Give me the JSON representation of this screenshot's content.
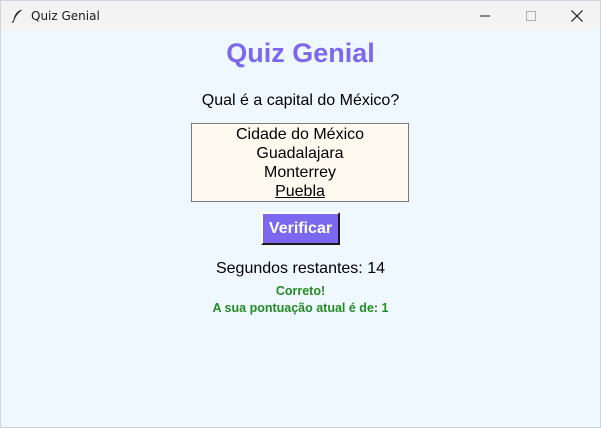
{
  "window": {
    "title": "Quiz Genial",
    "icon": "feather-icon",
    "controls": [
      "minimize-icon",
      "maximize-icon",
      "close-icon"
    ]
  },
  "quiz": {
    "heading": "Quiz Genial",
    "question": "Qual é a capital do México?",
    "options": [
      "Cidade do México",
      "Guadalajara",
      "Monterrey",
      "Puebla"
    ],
    "focused_option_index": 3,
    "check_button_label": "Verificar",
    "timer_text": "Segundos restantes: 14",
    "feedback_line1": "Correto!",
    "feedback_line2": "A sua pontuação atual é de: 1"
  },
  "colors": {
    "accent": "#7b68ee",
    "background": "#f0f8ff",
    "listbox_background": "#fffaf0",
    "feedback": "#228b22"
  }
}
